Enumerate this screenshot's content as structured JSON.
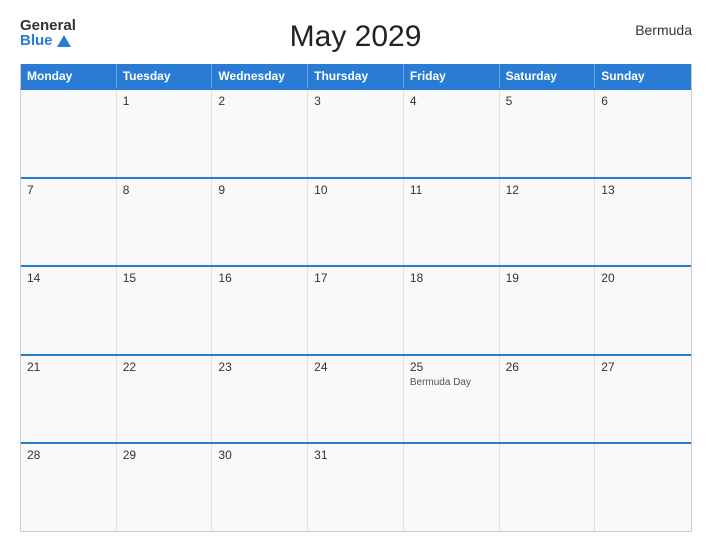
{
  "header": {
    "logo_general": "General",
    "logo_blue": "Blue",
    "title": "May 2029",
    "region": "Bermuda"
  },
  "calendar": {
    "days": [
      "Monday",
      "Tuesday",
      "Wednesday",
      "Thursday",
      "Friday",
      "Saturday",
      "Sunday"
    ],
    "weeks": [
      [
        {
          "num": "",
          "holiday": ""
        },
        {
          "num": "1",
          "holiday": ""
        },
        {
          "num": "2",
          "holiday": ""
        },
        {
          "num": "3",
          "holiday": ""
        },
        {
          "num": "4",
          "holiday": ""
        },
        {
          "num": "5",
          "holiday": ""
        },
        {
          "num": "6",
          "holiday": ""
        }
      ],
      [
        {
          "num": "7",
          "holiday": ""
        },
        {
          "num": "8",
          "holiday": ""
        },
        {
          "num": "9",
          "holiday": ""
        },
        {
          "num": "10",
          "holiday": ""
        },
        {
          "num": "11",
          "holiday": ""
        },
        {
          "num": "12",
          "holiday": ""
        },
        {
          "num": "13",
          "holiday": ""
        }
      ],
      [
        {
          "num": "14",
          "holiday": ""
        },
        {
          "num": "15",
          "holiday": ""
        },
        {
          "num": "16",
          "holiday": ""
        },
        {
          "num": "17",
          "holiday": ""
        },
        {
          "num": "18",
          "holiday": ""
        },
        {
          "num": "19",
          "holiday": ""
        },
        {
          "num": "20",
          "holiday": ""
        }
      ],
      [
        {
          "num": "21",
          "holiday": ""
        },
        {
          "num": "22",
          "holiday": ""
        },
        {
          "num": "23",
          "holiday": ""
        },
        {
          "num": "24",
          "holiday": ""
        },
        {
          "num": "25",
          "holiday": "Bermuda Day"
        },
        {
          "num": "26",
          "holiday": ""
        },
        {
          "num": "27",
          "holiday": ""
        }
      ],
      [
        {
          "num": "28",
          "holiday": ""
        },
        {
          "num": "29",
          "holiday": ""
        },
        {
          "num": "30",
          "holiday": ""
        },
        {
          "num": "31",
          "holiday": ""
        },
        {
          "num": "",
          "holiday": ""
        },
        {
          "num": "",
          "holiday": ""
        },
        {
          "num": "",
          "holiday": ""
        }
      ]
    ]
  }
}
